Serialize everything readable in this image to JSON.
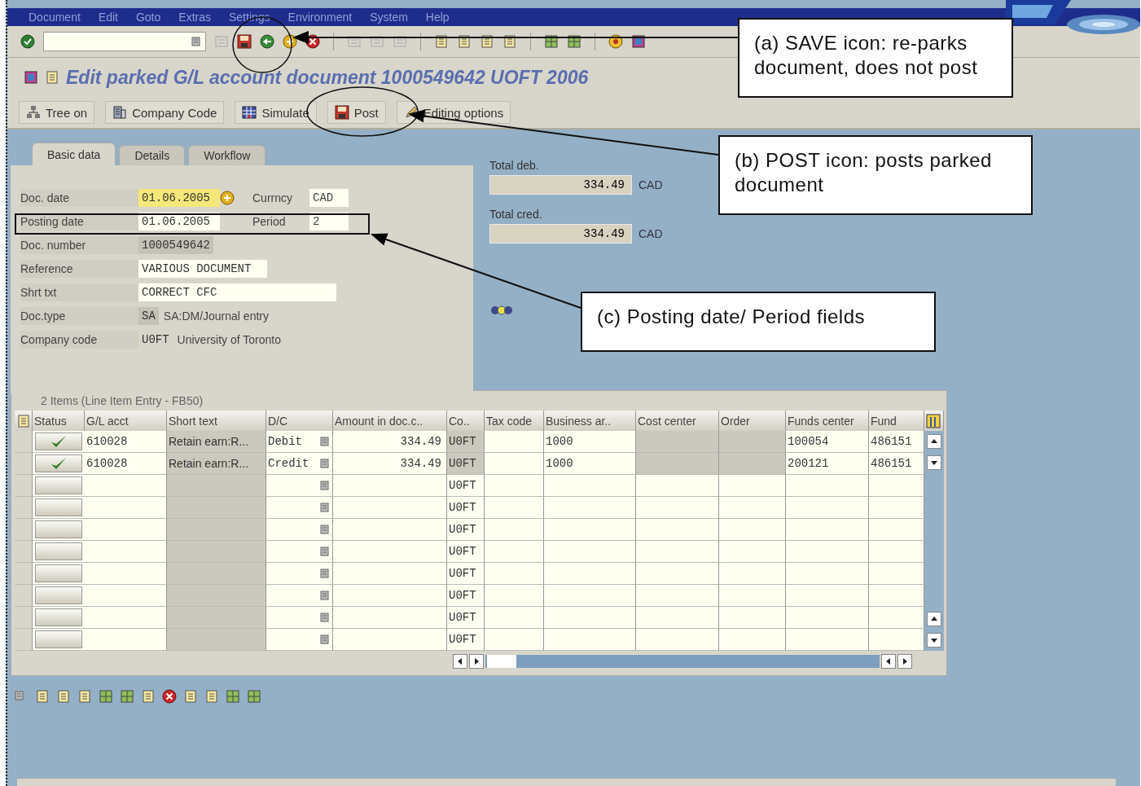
{
  "menu": [
    "Document",
    "Edit",
    "Goto",
    "Extras",
    "Settings",
    "Environment",
    "System",
    "Help"
  ],
  "title": "Edit parked G/L account document 1000549642 UOFT 2006",
  "app_toolbar": [
    {
      "label": "Tree on"
    },
    {
      "label": "Company Code"
    },
    {
      "label": "Simulate"
    },
    {
      "label": "Post"
    },
    {
      "label": "Editing options"
    }
  ],
  "tabs": [
    {
      "label": "Basic data",
      "selected": true
    },
    {
      "label": "Details",
      "selected": false
    },
    {
      "label": "Workflow",
      "selected": false
    }
  ],
  "header_fields": [
    {
      "label": "Doc. date",
      "value": "01.06.2005",
      "kind": "highlight",
      "extra_label": "Currncy",
      "extra_value": "CAD"
    },
    {
      "label": "Posting date",
      "value": "01.06.2005",
      "kind": "input",
      "extra_label": "Period",
      "extra_value": "2"
    },
    {
      "label": "Doc. number",
      "value": "1000549642",
      "kind": "display"
    },
    {
      "label": "Reference",
      "value": "VARIOUS DOCUMENT",
      "kind": "input"
    },
    {
      "label": "Shrt txt",
      "value": "CORRECT CFC",
      "kind": "wide"
    },
    {
      "label": "Doc.type",
      "value": "SA",
      "kind": "display",
      "note": "SA:DM/Journal entry"
    },
    {
      "label": "Company code",
      "value": "U0FT",
      "kind": "plain",
      "note": "University of Toronto"
    }
  ],
  "totals": [
    {
      "label": "Total deb.",
      "value": "334.49",
      "currency": "CAD"
    },
    {
      "label": "Total cred.",
      "value": "334.49",
      "currency": "CAD"
    }
  ],
  "table": {
    "title": "2 Items (Line Item Entry - FB50)",
    "columns": [
      "Status",
      "G/L acct",
      "Short text",
      "D/C",
      "Amount in doc.c..",
      "Co..",
      "Tax code",
      "Business ar..",
      "Cost center",
      "Order",
      "Funds center",
      "Fund"
    ],
    "rows": [
      {
        "checked": true,
        "gl_acct": "610028",
        "short_text": "Retain earn:R...",
        "dc": "Debit",
        "amount": "334.49",
        "co": "U0FT",
        "business_area": "1000",
        "funds_center": "100054",
        "fund": "486151"
      },
      {
        "checked": true,
        "gl_acct": "610028",
        "short_text": "Retain earn:R...",
        "dc": "Credit",
        "amount": "334.49",
        "co": "U0FT",
        "business_area": "1000",
        "funds_center": "200121",
        "fund": "486151"
      },
      {
        "checked": false,
        "co": "U0FT"
      },
      {
        "checked": false,
        "co": "U0FT"
      },
      {
        "checked": false,
        "co": "U0FT"
      },
      {
        "checked": false,
        "co": "U0FT"
      },
      {
        "checked": false,
        "co": "U0FT"
      },
      {
        "checked": false,
        "co": "U0FT"
      },
      {
        "checked": false,
        "co": "U0FT"
      },
      {
        "checked": false,
        "co": "U0FT"
      }
    ]
  },
  "callouts": [
    {
      "text": "(a) SAVE icon: re-parks document, does not post"
    },
    {
      "text": "(b) POST icon: posts parked document"
    },
    {
      "text": "(c) Posting date/ Period fields"
    }
  ]
}
